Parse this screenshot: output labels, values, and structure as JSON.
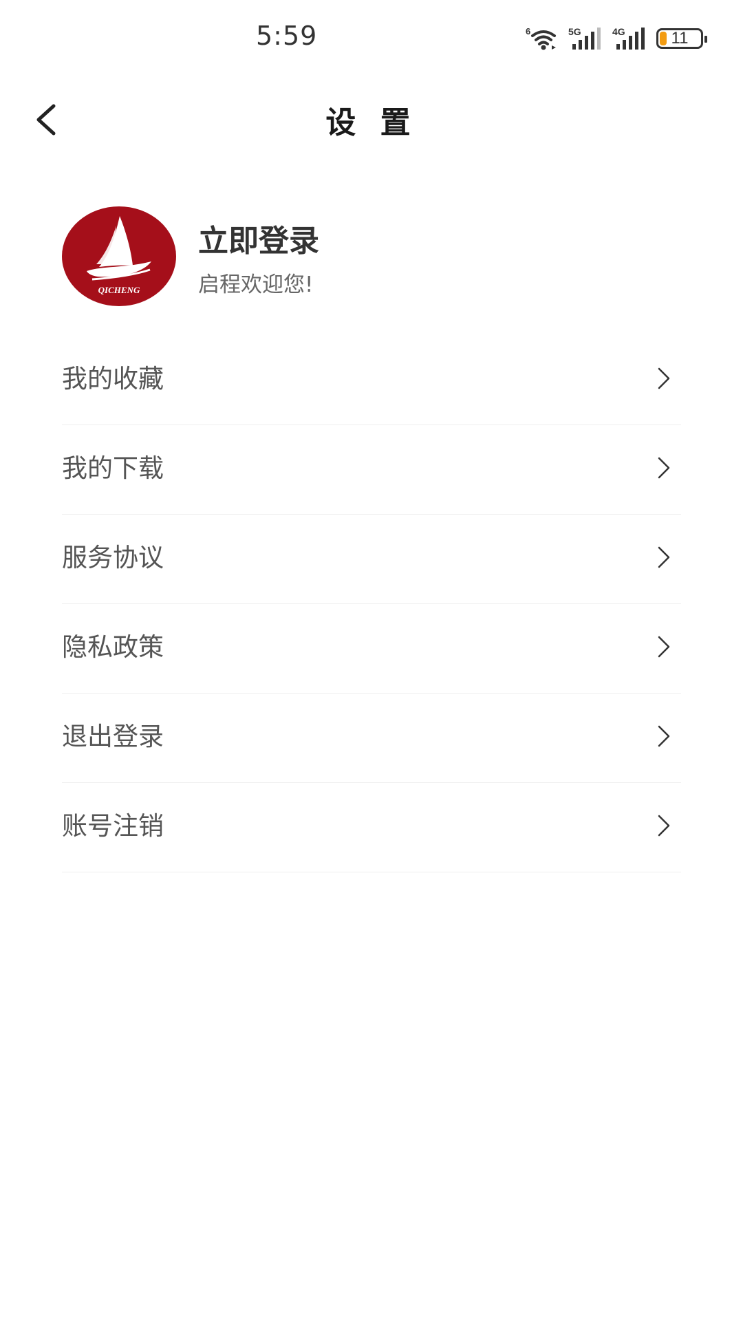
{
  "status_bar": {
    "time": "5:59",
    "wifi_label": "6",
    "signal1_label": "5G",
    "signal2_label": "4G",
    "battery_level": "11",
    "battery_color": "#f39c12"
  },
  "header": {
    "back_icon": "chevron-left-icon",
    "title": "设 置"
  },
  "profile": {
    "avatar_brand_text": "QICHENG",
    "avatar_color": "#a50f1a",
    "name": "立即登录",
    "subtitle": "启程欢迎您!"
  },
  "menu": {
    "items": [
      {
        "label": "我的收藏"
      },
      {
        "label": "我的下载"
      },
      {
        "label": "服务协议"
      },
      {
        "label": "隐私政策"
      },
      {
        "label": "退出登录"
      },
      {
        "label": "账号注销"
      }
    ],
    "arrow_icon": "chevron-right-icon"
  }
}
